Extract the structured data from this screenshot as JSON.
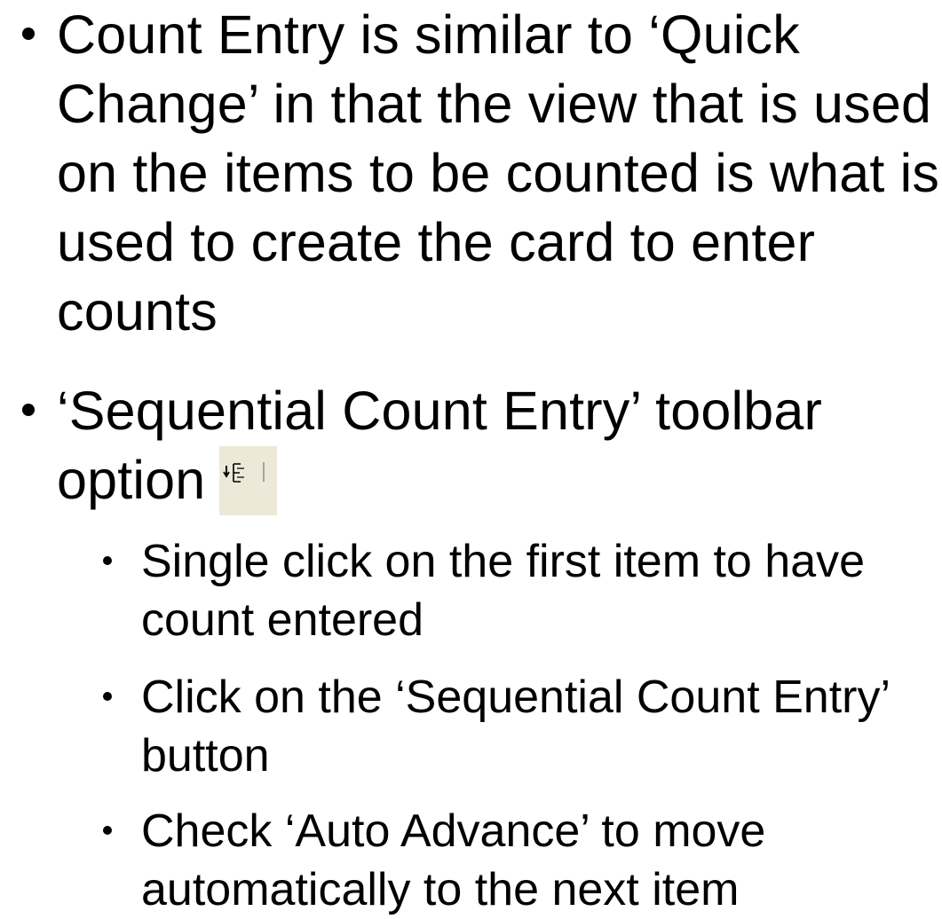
{
  "bullets": [
    {
      "text": "Count Entry is similar to ‘Quick Change’ in that the view that is used on the items to be counted is what is used to create the card to enter counts"
    },
    {
      "text": "‘Sequential Count Entry’ toolbar option",
      "icon": "sequential-count-entry-icon",
      "sub": [
        {
          "text": "Single click on the first item to have count entered"
        },
        {
          "text": "Click on the ‘Sequential Count Entry’ button"
        },
        {
          "text": "Check ‘Auto Advance’ to move automatically to the next item"
        }
      ]
    }
  ],
  "colors": {
    "text": "#000000",
    "background": "#ffffff",
    "icon_background": "#ece9d8"
  }
}
